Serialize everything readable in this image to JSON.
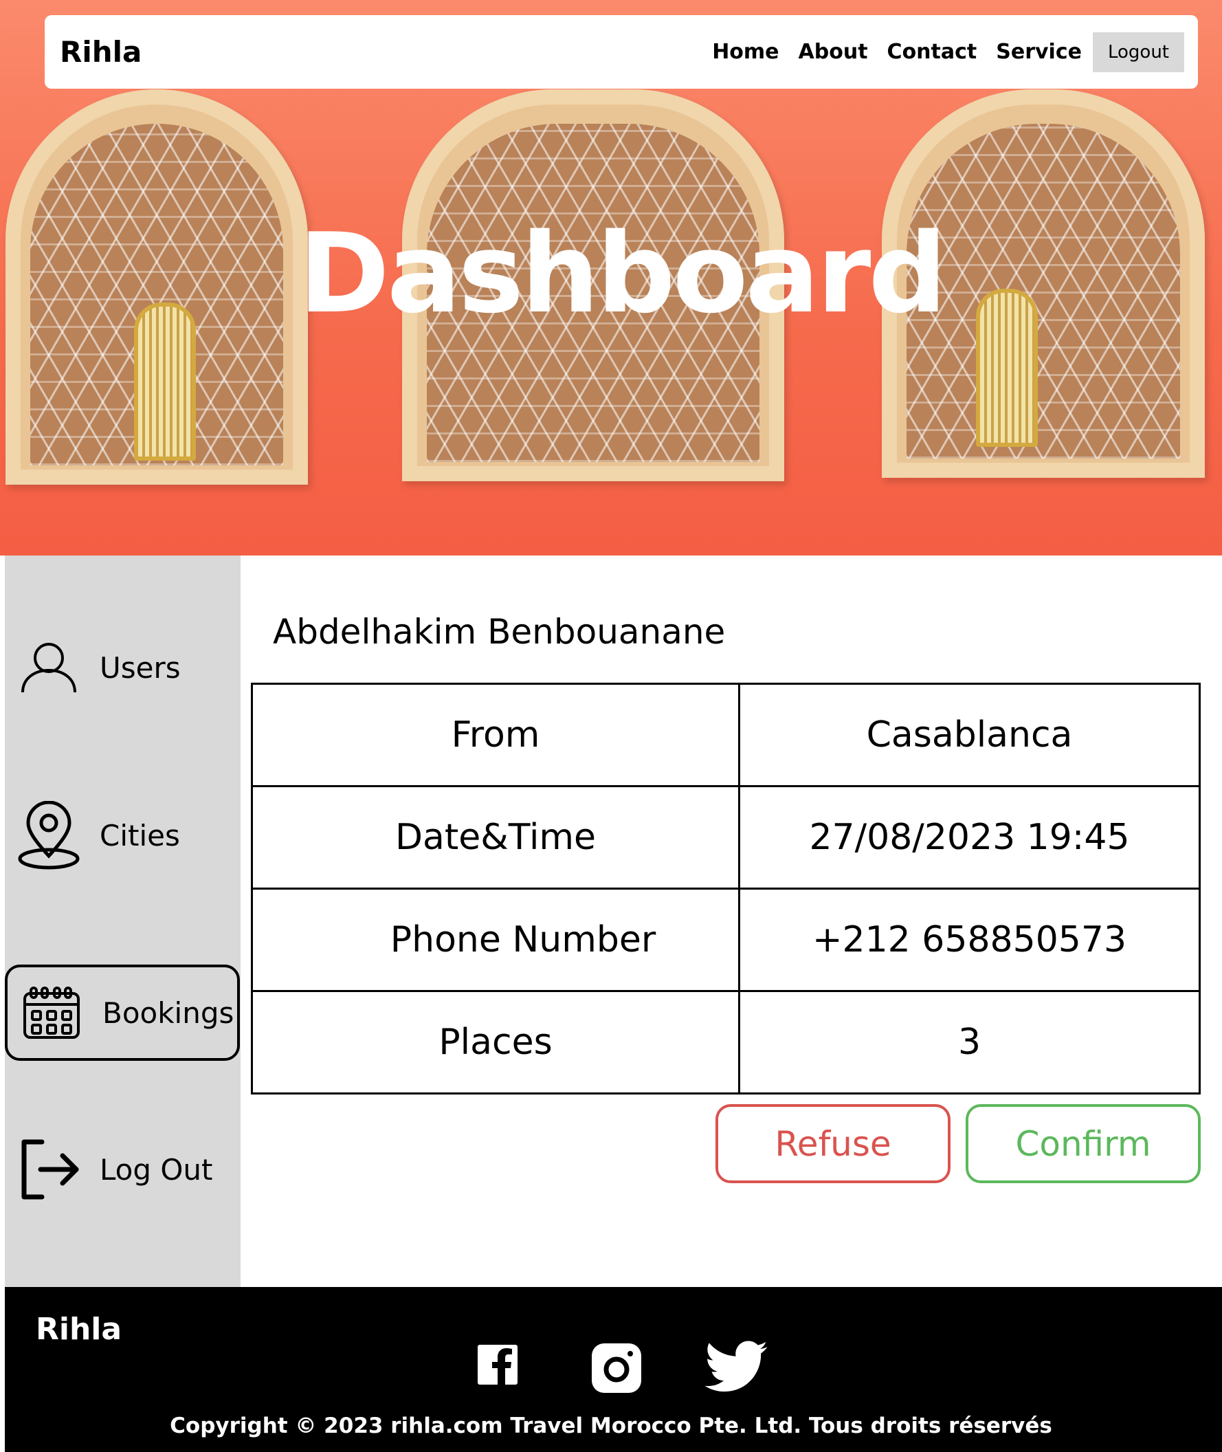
{
  "navbar": {
    "brand": "Rihla",
    "links": [
      "Home",
      "About",
      "Contact",
      "Service"
    ],
    "logout_label": "Logout"
  },
  "hero": {
    "title": "Dashboard"
  },
  "sidebar": {
    "items": [
      {
        "label": "Users",
        "icon": "user-icon"
      },
      {
        "label": "Cities",
        "icon": "map-pin-icon"
      },
      {
        "label": "Bookings",
        "icon": "calendar-icon",
        "active": true
      },
      {
        "label": "Log Out",
        "icon": "logout-icon"
      }
    ]
  },
  "booking": {
    "name": "Abdelhakim Benbouanane",
    "rows": [
      {
        "label": "From",
        "value": "Casablanca"
      },
      {
        "label": "Date&Time",
        "value": "27/08/2023 19:45"
      },
      {
        "label": "Phone Number",
        "value": "+212 658850573"
      },
      {
        "label": "Places",
        "value": "3"
      }
    ],
    "refuse_label": "Refuse",
    "confirm_label": "Confirm",
    "colors": {
      "refuse": "#d9534f",
      "confirm": "#5cb85c"
    }
  },
  "footer": {
    "brand": "Rihla",
    "social": [
      "facebook-icon",
      "instagram-icon",
      "twitter-icon"
    ],
    "copyright": "Copyright © 2023 rihla.com Travel Morocco Pte. Ltd. Tous droits réservés"
  }
}
